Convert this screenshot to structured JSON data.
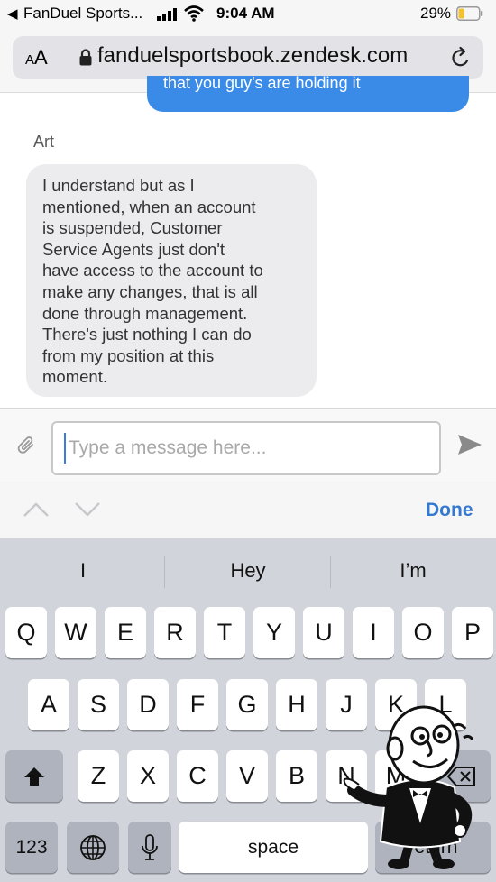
{
  "status_bar": {
    "back_app": "FanDuel Sports...",
    "time": "9:04 AM",
    "battery_percent": "29%",
    "battery_level": 0.29
  },
  "browser": {
    "text_size_label": "AA",
    "url": "fanduelsportsbook.zendesk.com"
  },
  "chat": {
    "previous_message": "that you guy's are holding it",
    "agent_name": "Art",
    "agent_message": "I understand but as I\nmentioned, when an account\nis suspended, Customer\nService Agents just don't\nhave access to the account to\nmake any changes, that is all\ndone through management.\nThere's just nothing I can do\nfrom my position at this\nmoment."
  },
  "composer": {
    "placeholder": "Type a message here...",
    "value": ""
  },
  "accessory_bar": {
    "done_label": "Done"
  },
  "keyboard": {
    "suggestions": [
      "I",
      "Hey",
      "I’m"
    ],
    "row1": [
      "Q",
      "W",
      "E",
      "R",
      "T",
      "Y",
      "U",
      "I",
      "O",
      "P"
    ],
    "row2": [
      "A",
      "S",
      "D",
      "F",
      "G",
      "H",
      "J",
      "K",
      "L"
    ],
    "row3": [
      "Z",
      "X",
      "C",
      "V",
      "B",
      "N",
      "M"
    ],
    "numbers_label": "123",
    "space_label": "space",
    "return_label": "return"
  },
  "icons": {
    "back": "back-arrow-icon",
    "signal": "cellular-signal-icon",
    "wifi": "wifi-icon",
    "battery": "battery-icon",
    "lock": "lock-icon",
    "reload": "reload-icon",
    "attach": "paperclip-icon",
    "send": "send-icon",
    "shift": "shift-icon",
    "globe": "globe-icon",
    "mic": "microphone-icon"
  },
  "colors": {
    "accent_blue": "#3478d0",
    "outgoing_bubble": "#3a8ae8",
    "incoming_bubble": "#ececee",
    "battery_fill": "#f2c230",
    "keyboard_bg": "#d1d4da"
  }
}
